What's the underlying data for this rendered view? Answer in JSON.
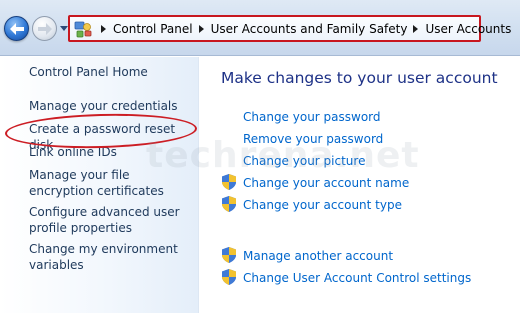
{
  "breadcrumb": {
    "items": [
      "Control Panel",
      "User Accounts and Family Safety",
      "User Accounts"
    ]
  },
  "sidebar": {
    "items": [
      {
        "label": "Control Panel Home"
      },
      {
        "label": "Manage your credentials"
      },
      {
        "label": "Create a password reset disk"
      },
      {
        "label": "Link online IDs"
      },
      {
        "label": "Manage your file encryption certificates"
      },
      {
        "label": "Configure advanced user profile properties"
      },
      {
        "label": "Change my environment variables"
      }
    ]
  },
  "main": {
    "title": "Make changes to your user account",
    "tasks": [
      {
        "label": "Change your password",
        "shield": false
      },
      {
        "label": "Remove your password",
        "shield": false
      },
      {
        "label": "Change your picture",
        "shield": false
      },
      {
        "label": "Change your account name",
        "shield": true
      },
      {
        "label": "Change your account type",
        "shield": true
      }
    ],
    "other_tasks": [
      {
        "label": "Manage another account",
        "shield": true
      },
      {
        "label": "Change User Account Control settings",
        "shield": true
      }
    ]
  },
  "watermark": "techrena.net",
  "icons": {
    "back": "back-arrow-icon",
    "forward": "forward-arrow-icon",
    "recent": "chevron-down-icon",
    "control_panel": "control-panel-icon",
    "shield": "uac-shield-icon"
  },
  "colors": {
    "link": "#0066cc",
    "title": "#1e3287",
    "sidebar_text": "#1e395b",
    "highlight": "#cc1d24"
  }
}
